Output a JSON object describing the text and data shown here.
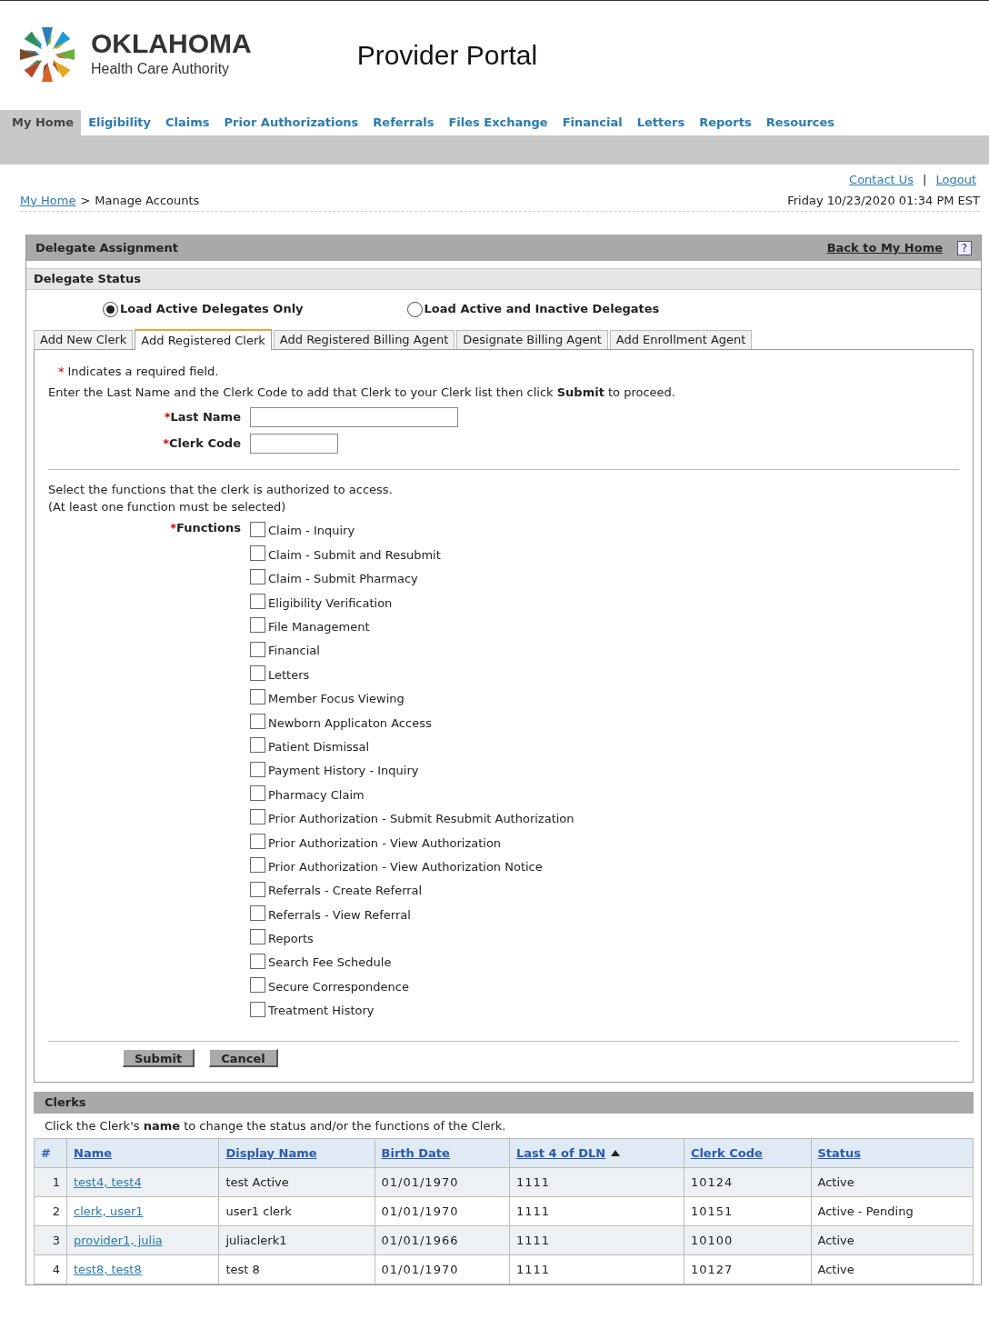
{
  "header": {
    "org_name": "OKLAHOMA",
    "org_subtitle": "Health Care Authority",
    "portal_title": "Provider Portal"
  },
  "nav": [
    {
      "label": "My Home",
      "selected": true
    },
    {
      "label": "Eligibility",
      "selected": false
    },
    {
      "label": "Claims",
      "selected": false
    },
    {
      "label": "Prior Authorizations",
      "selected": false
    },
    {
      "label": "Referrals",
      "selected": false
    },
    {
      "label": "Files Exchange",
      "selected": false
    },
    {
      "label": "Financial",
      "selected": false
    },
    {
      "label": "Letters",
      "selected": false
    },
    {
      "label": "Reports",
      "selected": false
    },
    {
      "label": "Resources",
      "selected": false
    }
  ],
  "top_links": [
    "Contact Us",
    "Logout"
  ],
  "top_links_separator": "|",
  "breadcrumb": {
    "home": "My Home",
    "separator": ">",
    "current": "Manage Accounts"
  },
  "datetime": "Friday 10/23/2020 01:34 PM EST",
  "panel": {
    "title": "Delegate Assignment",
    "back_link": "Back to My Home",
    "help": "?"
  },
  "delegate_status": {
    "title": "Delegate Status",
    "options": [
      {
        "label": "Load Active Delegates Only",
        "selected": true
      },
      {
        "label": "Load Active and Inactive Delegates",
        "selected": false
      }
    ]
  },
  "tabs": [
    {
      "label": "Add New Clerk",
      "selected": false
    },
    {
      "label": "Add Registered Clerk",
      "selected": true
    },
    {
      "label": "Add Registered Billing Agent",
      "selected": false
    },
    {
      "label": "Designate Billing Agent",
      "selected": false
    },
    {
      "label": "Add Enrollment Agent",
      "selected": false
    }
  ],
  "form": {
    "required_note": {
      "mark": "*",
      "text": "Indicates a required field."
    },
    "instructions": "Enter the Last Name and the Clerk Code to add that Clerk to your Clerk list then click **Submit** to proceed.",
    "fields": [
      {
        "mark": "*",
        "label": "Last Name"
      },
      {
        "mark": "*",
        "label": "Clerk Code"
      }
    ],
    "functions_intro": [
      "Select the functions that the clerk is authorized to access.",
      "(At least one function must be selected)"
    ],
    "functions_label": {
      "mark": "*",
      "label": "Functions"
    },
    "functions": [
      {
        "label": "Claim - Inquiry",
        "checked": false
      },
      {
        "label": "Claim - Submit and Resubmit",
        "checked": false
      },
      {
        "label": "Claim - Submit Pharmacy",
        "checked": false
      },
      {
        "label": "Eligibility Verification",
        "checked": false
      },
      {
        "label": "File Management",
        "checked": false
      },
      {
        "label": "Financial",
        "checked": false
      },
      {
        "label": "Letters",
        "checked": false
      },
      {
        "label": "Member Focus Viewing",
        "checked": false
      },
      {
        "label": "Newborn Applicaton Access",
        "checked": false
      },
      {
        "label": "Patient Dismissal",
        "checked": false
      },
      {
        "label": "Payment History - Inquiry",
        "checked": false
      },
      {
        "label": "Pharmacy Claim",
        "checked": false
      },
      {
        "label": "Prior Authorization - Submit Resubmit Authorization",
        "checked": false
      },
      {
        "label": "Prior Authorization - View Authorization",
        "checked": false
      },
      {
        "label": "Prior Authorization - View Authorization Notice",
        "checked": false
      },
      {
        "label": "Referrals - Create Referral",
        "checked": false
      },
      {
        "label": "Referrals - View Referral",
        "checked": false
      },
      {
        "label": "Reports",
        "checked": false
      },
      {
        "label": "Search Fee Schedule",
        "checked": false
      },
      {
        "label": "Secure Correspondence",
        "checked": false
      },
      {
        "label": "Treatment History",
        "checked": false
      }
    ],
    "buttons": [
      "Submit",
      "Cancel"
    ]
  },
  "clerks": {
    "title": "Clerks",
    "hint": "Click the Clerk's **name** to change the status and/or the functions of the Clerk.",
    "columns": [
      {
        "label": "#",
        "link": false,
        "sorted": false
      },
      {
        "label": "Name",
        "link": true,
        "sorted": false
      },
      {
        "label": "Display Name",
        "link": true,
        "sorted": false
      },
      {
        "label": "Birth Date",
        "link": true,
        "sorted": false
      },
      {
        "label": "Last 4 of DLN",
        "link": true,
        "sorted": true
      },
      {
        "label": "Clerk Code",
        "link": true,
        "sorted": false
      },
      {
        "label": "Status",
        "link": true,
        "sorted": false
      }
    ],
    "rows": [
      [
        "1",
        "test4, test4",
        "test Active",
        "01/01/1970",
        "1111",
        "10124",
        "Active"
      ],
      [
        "2",
        "clerk, user1",
        "user1 clerk",
        "01/01/1970",
        "1111",
        "10151",
        "Active - Pending"
      ],
      [
        "3",
        "provider1, julia",
        "juliaclerk1",
        "01/01/1966",
        "1111",
        "10100",
        "Active"
      ],
      [
        "4",
        "test8, test8",
        "test 8",
        "01/01/1970",
        "1111",
        "10127",
        "Active"
      ]
    ]
  }
}
